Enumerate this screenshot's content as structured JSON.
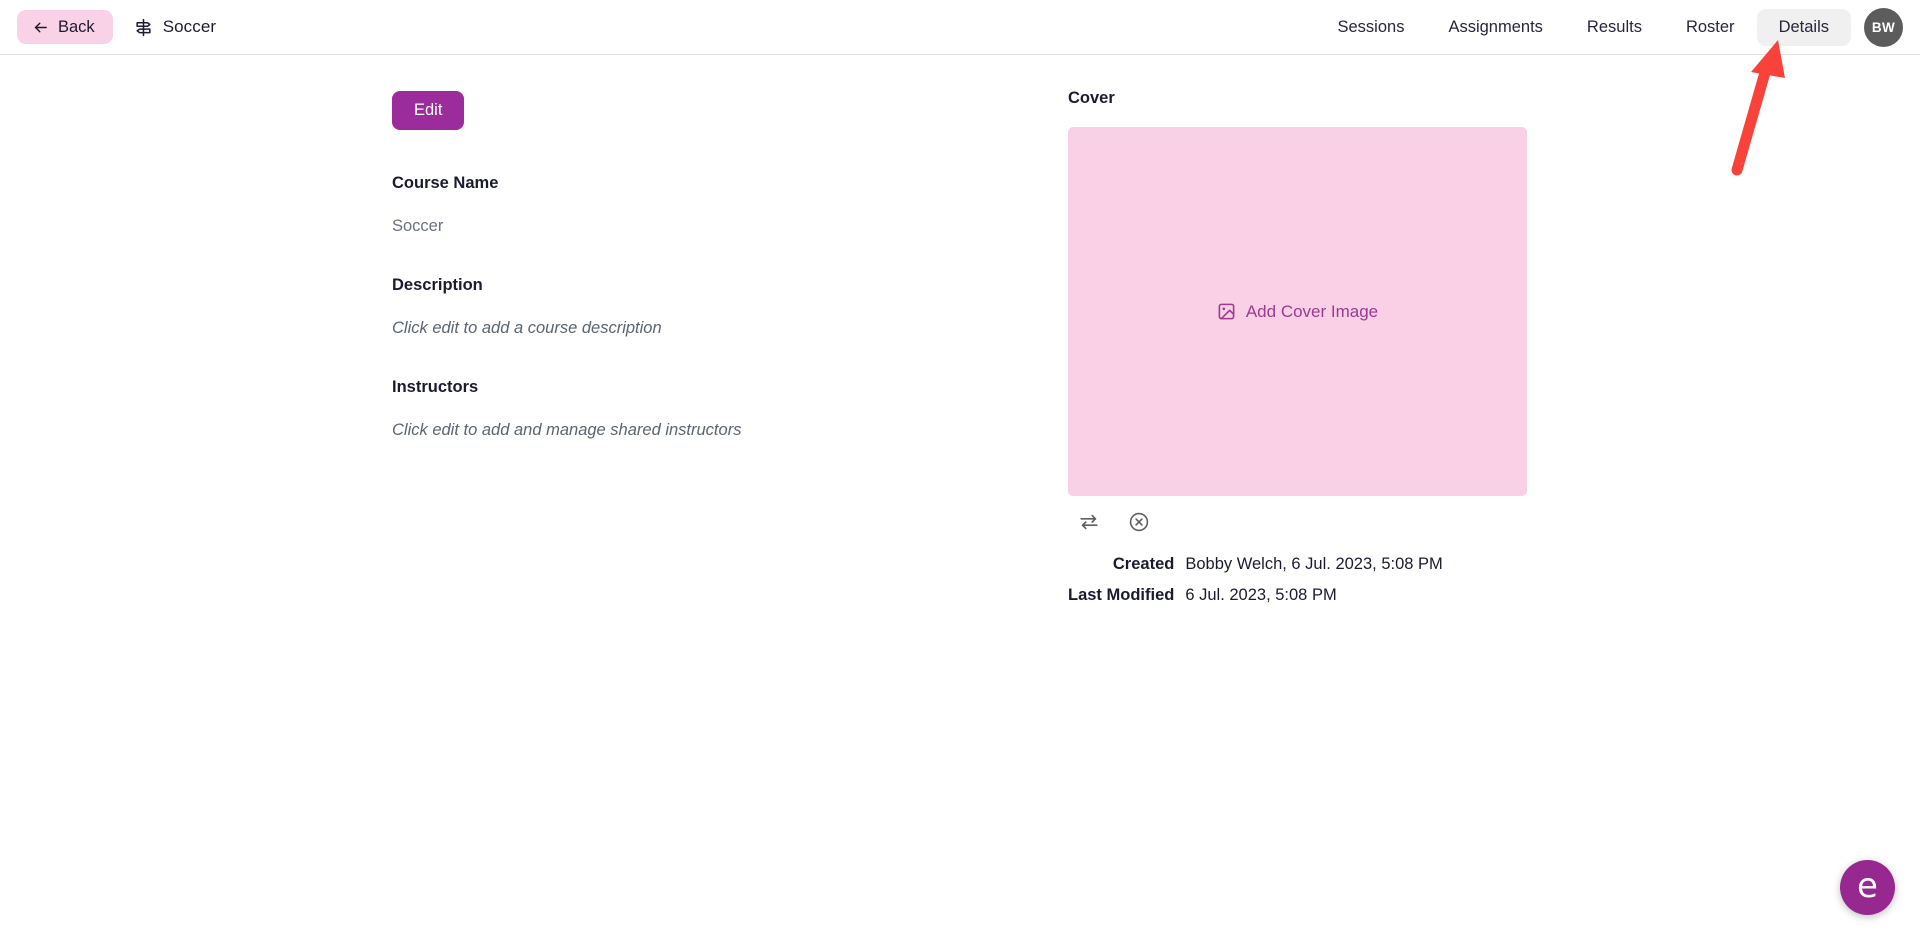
{
  "header": {
    "back_label": "Back",
    "back_icon": "arrow-left-icon",
    "course_icon": "signpost-icon",
    "course_title": "Soccer",
    "nav_tabs": [
      {
        "label": "Sessions",
        "active": false
      },
      {
        "label": "Assignments",
        "active": false
      },
      {
        "label": "Results",
        "active": false
      },
      {
        "label": "Roster",
        "active": false
      },
      {
        "label": "Details",
        "active": true
      }
    ],
    "avatar_initials": "BW"
  },
  "details": {
    "edit_label": "Edit",
    "course_name_label": "Course Name",
    "course_name_value": "Soccer",
    "description_label": "Description",
    "description_placeholder": "Click edit to add a course description",
    "instructors_label": "Instructors",
    "instructors_placeholder": "Click edit to add and manage shared instructors"
  },
  "cover": {
    "label": "Cover",
    "add_label": "Add Cover Image",
    "add_icon": "image-icon",
    "swap_icon": "swap-arrows-icon",
    "remove_icon": "circle-x-icon"
  },
  "meta": {
    "created_label": "Created",
    "created_value": "Bobby Welch, 6 Jul. 2023, 5:08 PM",
    "modified_label": "Last Modified",
    "modified_value": "6 Jul. 2023, 5:08 PM"
  },
  "chat": {
    "icon": "chat-launcher-icon",
    "glyph": "e"
  },
  "colors": {
    "brand_purple": "#9c2b9c",
    "cover_pink": "#fad0e7",
    "back_pink": "#fad2e8",
    "annotation_red": "#f9423a",
    "avatar_gray": "#5c5c5c"
  }
}
